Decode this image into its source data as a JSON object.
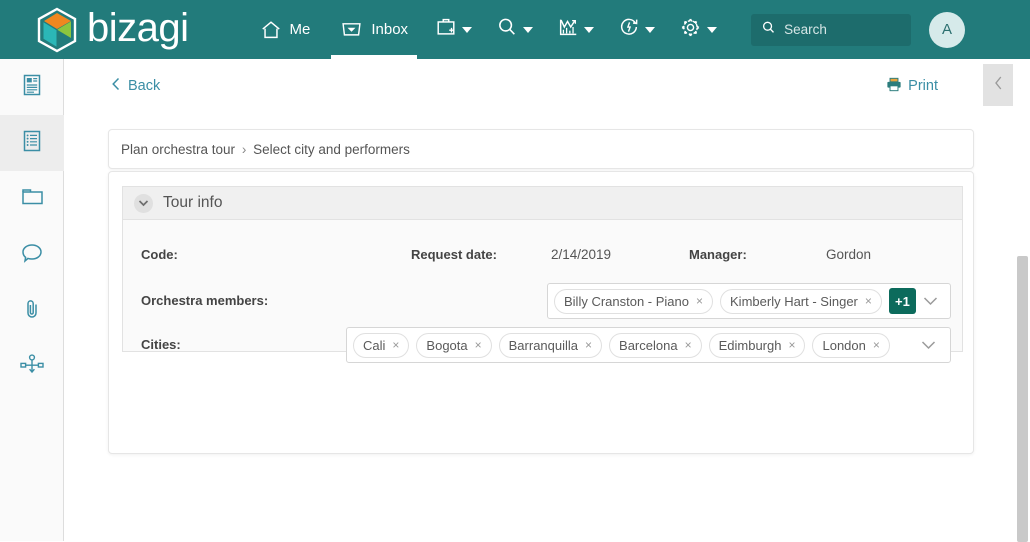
{
  "brand": {
    "name": "bizagi",
    "primary_color": "#227B7B",
    "accent_color": "#0C6B5C",
    "link_color": "#3B8EA5"
  },
  "topnav": {
    "items": [
      {
        "label": "Me",
        "icon": "home-icon",
        "active": false
      },
      {
        "label": "Inbox",
        "icon": "inbox-icon",
        "active": true
      }
    ],
    "icon_menus": [
      {
        "icon": "new-case-icon",
        "has_caret": true
      },
      {
        "icon": "search-icon",
        "has_caret": true
      },
      {
        "icon": "analytics-icon",
        "has_caret": true
      },
      {
        "icon": "stopwatch-icon",
        "has_caret": true
      },
      {
        "icon": "gear-icon",
        "has_caret": true
      }
    ],
    "search": {
      "placeholder": "Search",
      "value": ""
    },
    "avatar_initial": "A"
  },
  "sidebar": {
    "items": [
      {
        "icon": "form-icon",
        "active": false
      },
      {
        "icon": "summary-list-icon",
        "active": true
      },
      {
        "icon": "folder-icon",
        "active": false
      },
      {
        "icon": "comment-icon",
        "active": false
      },
      {
        "icon": "attachment-icon",
        "active": false
      },
      {
        "icon": "process-diagram-icon",
        "active": false
      }
    ]
  },
  "toolbar": {
    "back_label": "Back",
    "print_label": "Print",
    "collapse_icon": "chevron-left-icon"
  },
  "breadcrumb": {
    "parent": "Plan orchestra tour",
    "separator": "›",
    "current": "Select city and performers"
  },
  "panel": {
    "title": "Tour info",
    "collapse_icon": "chevron-down-icon",
    "fields": {
      "code": {
        "label": "Code:",
        "value": ""
      },
      "request_date": {
        "label": "Request date:",
        "value": "2/14/2019"
      },
      "manager": {
        "label": "Manager:",
        "value": "Gordon"
      },
      "orchestra_members": {
        "label": "Orchestra members:",
        "chips": [
          {
            "text": "Billy Cranston - Piano",
            "remove": "×"
          },
          {
            "text": "Kimberly Hart - Singer",
            "remove": "×"
          }
        ],
        "overflow_badge": "+1",
        "dropdown_icon": "chevron-down-icon"
      },
      "cities": {
        "label": "Cities:",
        "chips": [
          {
            "text": "Cali",
            "remove": "×"
          },
          {
            "text": "Bogota",
            "remove": "×"
          },
          {
            "text": "Barranquilla",
            "remove": "×"
          },
          {
            "text": "Barcelona",
            "remove": "×"
          },
          {
            "text": "Edimburgh",
            "remove": "×"
          },
          {
            "text": "London",
            "remove": "×"
          }
        ],
        "dropdown_icon": "chevron-down-icon"
      }
    }
  }
}
